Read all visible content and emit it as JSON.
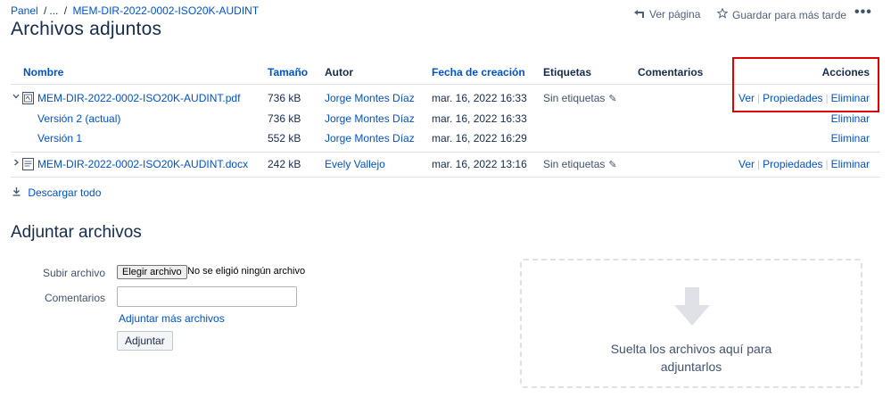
{
  "breadcrumb": {
    "root": "Panel",
    "ellipsis": "...",
    "current": "MEM-DIR-2022-0002-ISO20K-AUDINT"
  },
  "page_title": "Archivos adjuntos",
  "page_actions": {
    "view_page": "Ver página",
    "view_page_icon": "back-arrow-icon",
    "save_later": "Guardar para más tarde",
    "save_later_icon": "star-icon",
    "more": "•••"
  },
  "table": {
    "headers": {
      "name": "Nombre",
      "size": "Tamaño",
      "author": "Autor",
      "created": "Fecha de creación",
      "labels": "Etiquetas",
      "comments": "Comentarios",
      "actions": "Acciones"
    },
    "rows": [
      {
        "name": "MEM-DIR-2022-0002-ISO20K-AUDINT.pdf",
        "size": "736 kB",
        "author": "Jorge Montes Díaz",
        "created": "mar. 16, 2022 16:33",
        "labels": "Sin etiquetas",
        "actions": {
          "view": "Ver",
          "properties": "Propiedades",
          "delete": "Eliminar"
        },
        "expanded": true
      },
      {
        "name": "Versión 2 (actual)",
        "size": "736 kB",
        "author": "Jorge Montes Díaz",
        "created": "mar. 16, 2022 16:33",
        "actions": {
          "delete": "Eliminar"
        }
      },
      {
        "name": "Versión 1",
        "size": "552 kB",
        "author": "Jorge Montes Díaz",
        "created": "mar. 16, 2022 16:29",
        "actions": {
          "delete": "Eliminar"
        }
      },
      {
        "name": "MEM-DIR-2022-0002-ISO20K-AUDINT.docx",
        "size": "242 kB",
        "author": "Evely Vallejo",
        "created": "mar. 16, 2022 13:16",
        "labels": "Sin etiquetas",
        "actions": {
          "view": "Ver",
          "properties": "Propiedades",
          "delete": "Eliminar"
        },
        "expanded": false
      }
    ]
  },
  "download_all": "Descargar todo",
  "attach_section": {
    "title": "Adjuntar archivos",
    "upload_label": "Subir archivo",
    "choose_file": "Elegir archivo",
    "no_file": "No se eligió ningún archivo",
    "comments_label": "Comentarios",
    "comments_value": "",
    "more_files": "Adjuntar más archivos",
    "attach_button": "Adjuntar"
  },
  "dropzone": {
    "line1": "Suelta los archivos aquí para",
    "line2": "adjuntarlos"
  },
  "colors": {
    "link": "#0052cc",
    "text": "#172b4d",
    "highlight_border": "#e00000"
  }
}
